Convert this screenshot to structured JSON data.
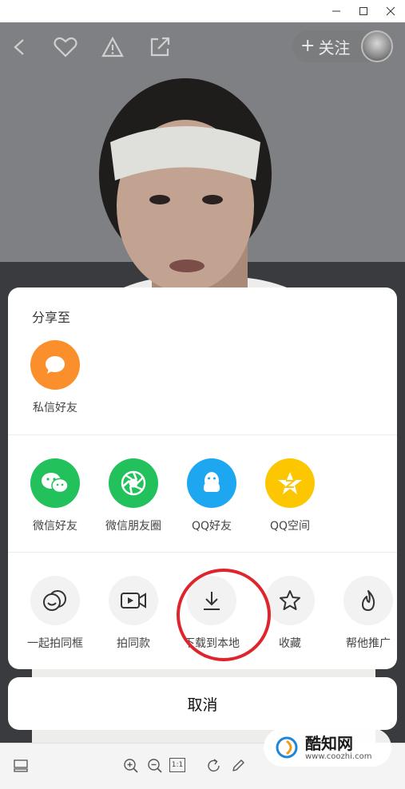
{
  "header": {
    "follow_plus": "+",
    "follow_label": "关注"
  },
  "share": {
    "title": "分享至",
    "row1": [
      {
        "label": "私信好友",
        "icon": "chat-bubble-icon",
        "color": "#fa8f2c"
      }
    ],
    "row2": [
      {
        "label": "微信好友",
        "icon": "wechat-icon",
        "color": "#22c15b"
      },
      {
        "label": "微信朋友圈",
        "icon": "wechat-moments-icon",
        "color": "#22c15b"
      },
      {
        "label": "QQ好友",
        "icon": "qq-icon",
        "color": "#1ea7f1"
      },
      {
        "label": "QQ空间",
        "icon": "qzone-icon",
        "color": "#fcc700"
      }
    ],
    "row3": [
      {
        "label": "一起拍同框",
        "icon": "duet-icon"
      },
      {
        "label": "拍同款",
        "icon": "video-camera-icon"
      },
      {
        "label": "下载到本地",
        "icon": "download-icon"
      },
      {
        "label": "收藏",
        "icon": "star-icon"
      },
      {
        "label": "帮他推广",
        "icon": "flame-icon"
      }
    ],
    "cancel_label": "取消"
  },
  "toolbar": {
    "ratio_label": "1:1"
  },
  "watermark": {
    "name": "酷知网",
    "url": "www.coozhi.com"
  },
  "colors": {
    "highlight_ring": "#e0242b",
    "secondary_icon_bg": "#f2f2f2"
  }
}
